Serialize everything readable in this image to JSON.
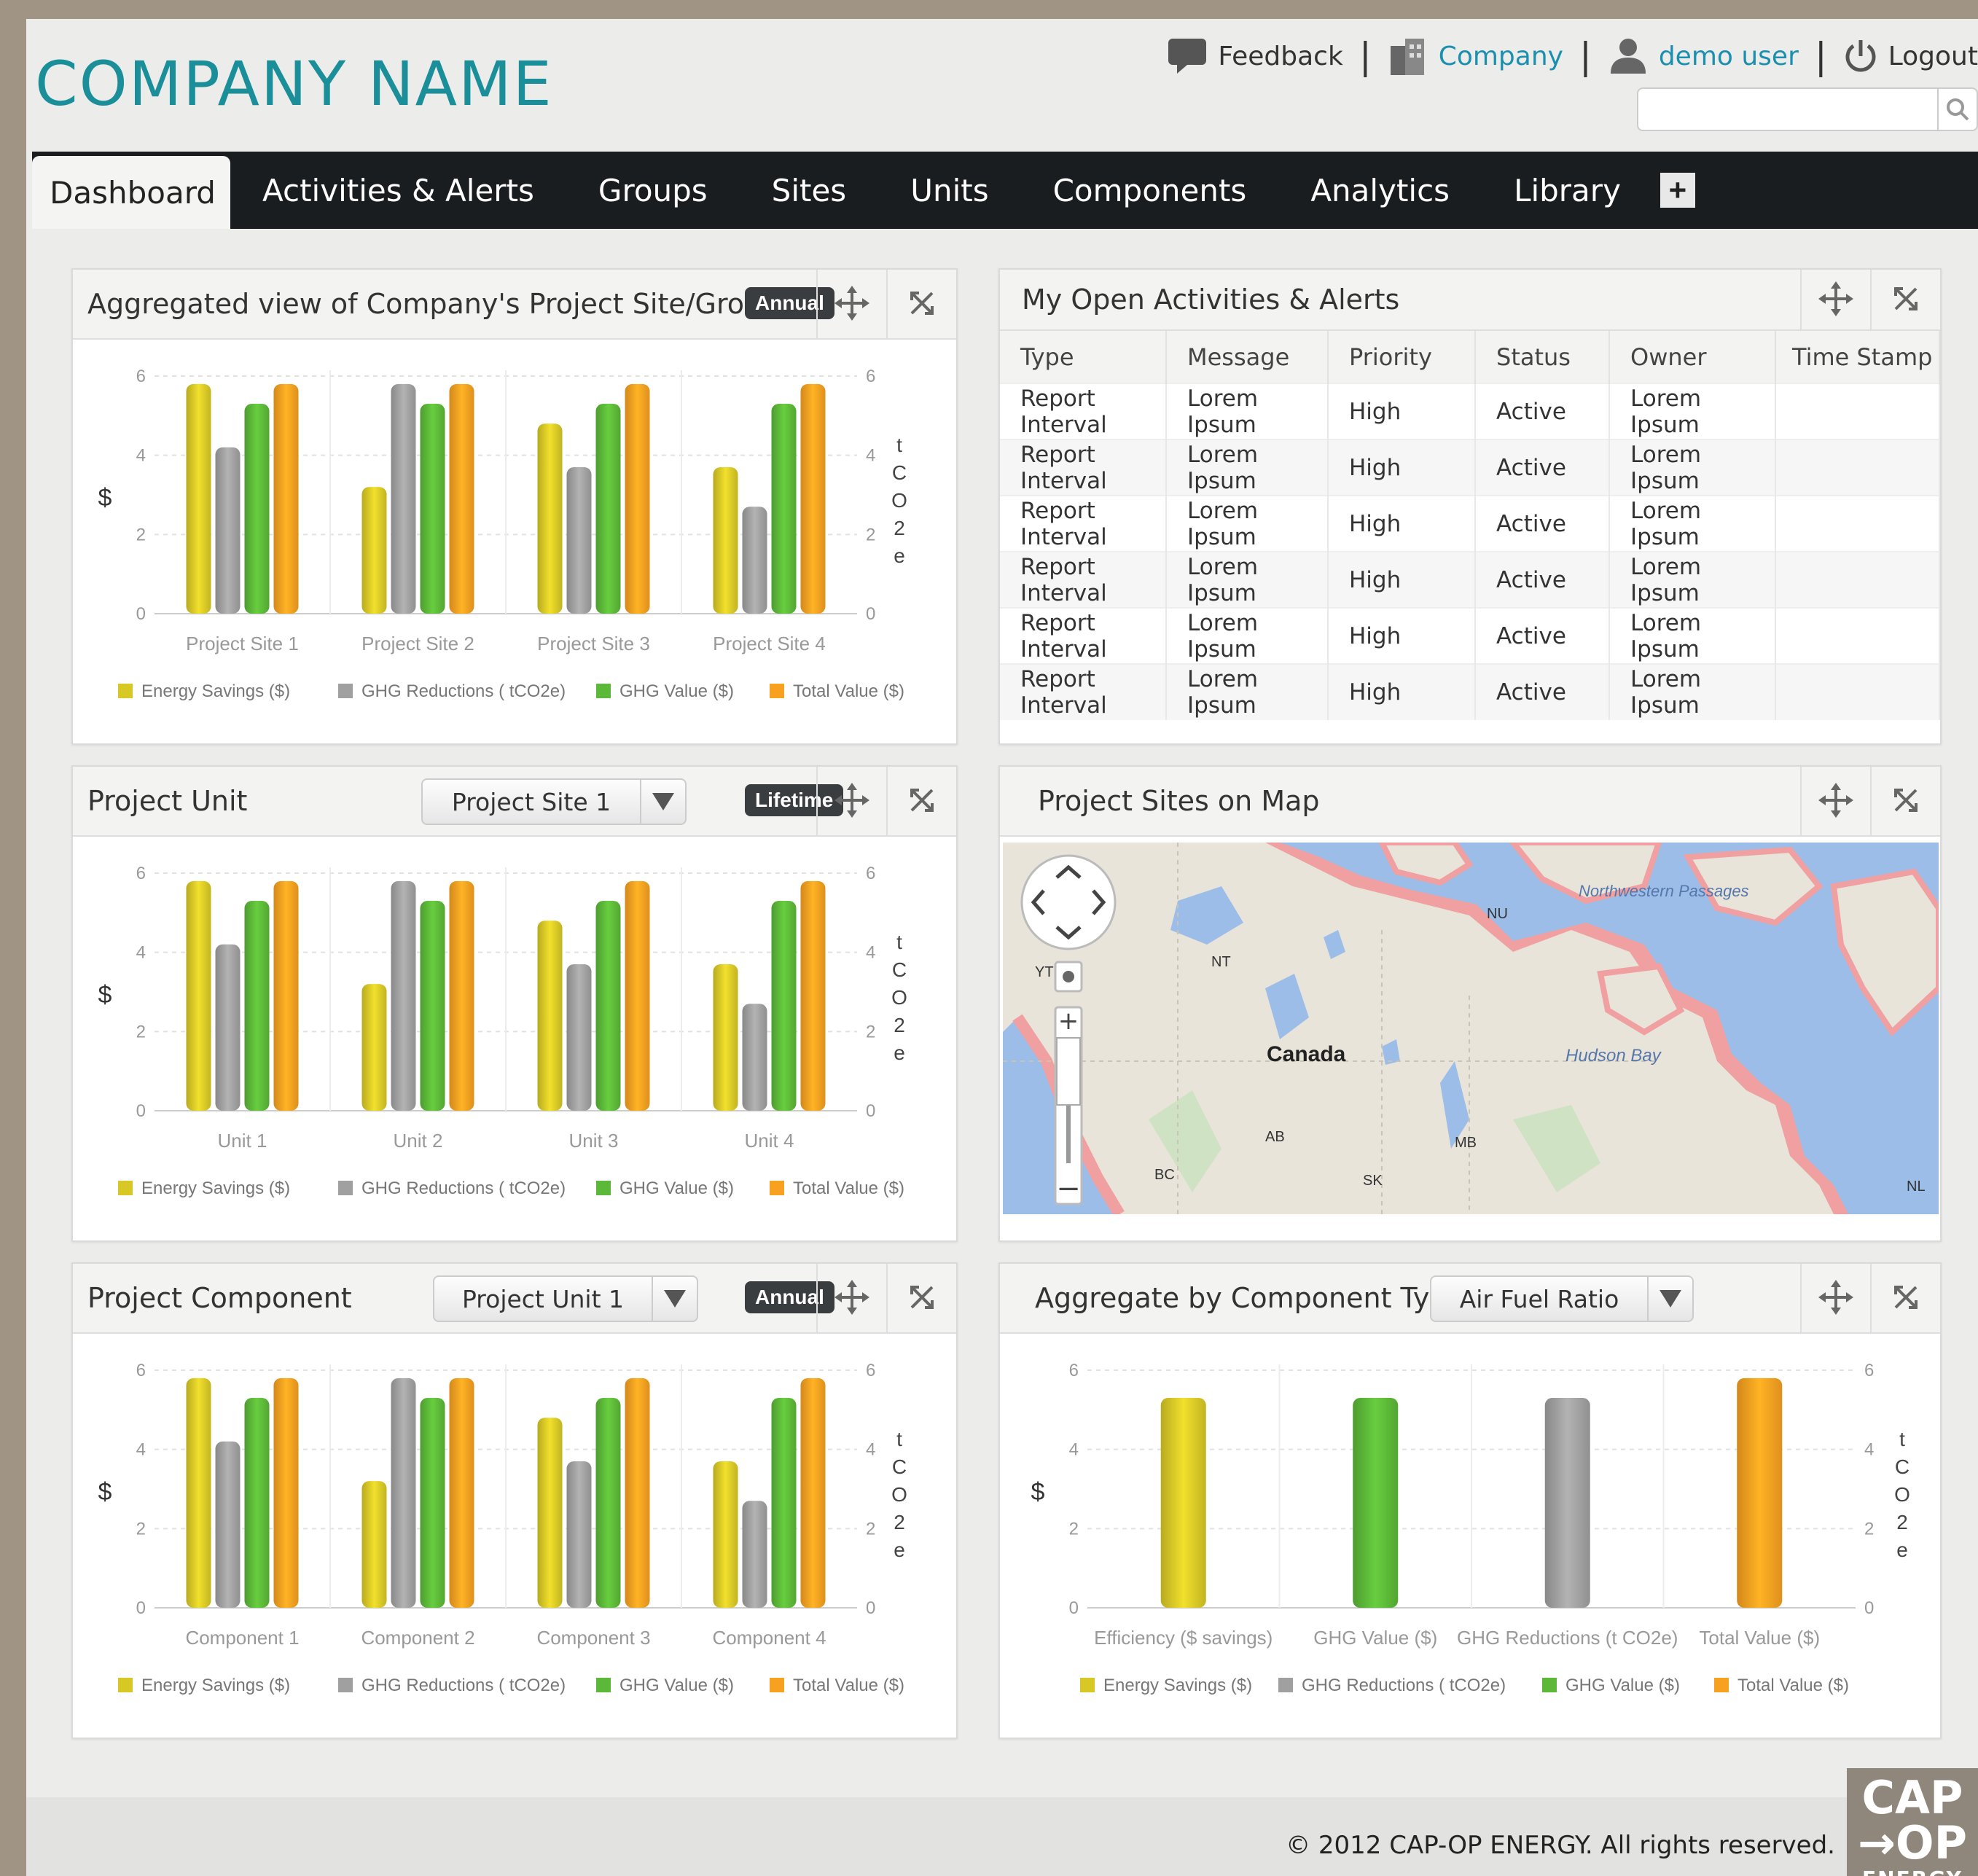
{
  "header": {
    "logo": "COMPANY NAME",
    "feedback": "Feedback",
    "company": "Company",
    "user": "demo user",
    "logout": "Logout",
    "search_placeholder": ""
  },
  "nav": {
    "tabs": [
      "Dashboard",
      "Activities & Alerts",
      "Groups",
      "Sites",
      "Units",
      "Components",
      "Analytics",
      "Library"
    ],
    "active": "Dashboard",
    "add_label": "+"
  },
  "legend": [
    "Energy Savings ($)",
    "GHG Reductions ( tCO2e)",
    "GHG Value ($)",
    "Total Value ($)"
  ],
  "colors": {
    "energy": "#d8c826",
    "ghg_red": "#a0a0a0",
    "ghg_val": "#5cb838",
    "total": "#f8a020",
    "accent": "#1a8f9a"
  },
  "axis": {
    "left_label": "$",
    "right_label": [
      "t",
      "C",
      "O",
      "2",
      "e"
    ]
  },
  "panels": {
    "aggregated": {
      "title": "Aggregated view of Company's  Project Site/Group",
      "badge": "Annual"
    },
    "activities": {
      "title": "My Open Activities & Alerts",
      "columns": [
        "Type",
        "Message",
        "Priority",
        "Status",
        "Owner",
        "Time Stamp"
      ],
      "rows": [
        [
          "Report Interval",
          "Lorem Ipsum",
          "High",
          "Active",
          "Lorem Ipsum",
          ""
        ],
        [
          "Report Interval",
          "Lorem Ipsum",
          "High",
          "Active",
          "Lorem Ipsum",
          ""
        ],
        [
          "Report Interval",
          "Lorem Ipsum",
          "High",
          "Active",
          "Lorem Ipsum",
          ""
        ],
        [
          "Report Interval",
          "Lorem Ipsum",
          "High",
          "Active",
          "Lorem Ipsum",
          ""
        ],
        [
          "Report Interval",
          "Lorem Ipsum",
          "High",
          "Active",
          "Lorem Ipsum",
          ""
        ],
        [
          "Report Interval",
          "Lorem Ipsum",
          "High",
          "Active",
          "Lorem Ipsum",
          ""
        ]
      ]
    },
    "unit": {
      "title": "Project Unit",
      "select": "Project Site 1",
      "badge": "Lifetime"
    },
    "map": {
      "title": "Project Sites on Map",
      "labels": [
        "Canada",
        "Hudson Bay",
        "Northwestern Passages",
        "NU",
        "NT",
        "YT",
        "AB",
        "MB",
        "BC",
        "SK",
        "NL"
      ]
    },
    "component": {
      "title": "Project Component",
      "select": "Project Unit 1",
      "badge": "Annual"
    },
    "aggregate_type": {
      "title": "Aggregate by Component Type:",
      "select": "Air Fuel Ratio"
    }
  },
  "chart_data": [
    {
      "type": "bar",
      "categories": [
        "Project Site 1",
        "Project Site 2",
        "Project Site 3",
        "Project Site 4"
      ],
      "series": [
        {
          "name": "Energy Savings ($)",
          "values": [
            5.8,
            3.2,
            4.8,
            3.7
          ]
        },
        {
          "name": "GHG Reductions ( tCO2e)",
          "values": [
            4.2,
            5.8,
            3.7,
            2.7
          ]
        },
        {
          "name": "GHG Value ($)",
          "values": [
            5.3,
            5.3,
            5.3,
            5.3
          ]
        },
        {
          "name": "Total Value ($)",
          "values": [
            5.8,
            5.8,
            5.8,
            5.8
          ]
        }
      ],
      "ylim": [
        0,
        6
      ],
      "yticks": [
        0,
        2,
        4,
        6
      ],
      "ylabel": "$",
      "y2label": "tCO2e"
    },
    {
      "type": "bar",
      "categories": [
        "Unit 1",
        "Unit 2",
        "Unit 3",
        "Unit 4"
      ],
      "series": [
        {
          "name": "Energy Savings ($)",
          "values": [
            5.8,
            3.2,
            4.8,
            3.7
          ]
        },
        {
          "name": "GHG Reductions ( tCO2e)",
          "values": [
            4.2,
            5.8,
            3.7,
            2.7
          ]
        },
        {
          "name": "GHG Value ($)",
          "values": [
            5.3,
            5.3,
            5.3,
            5.3
          ]
        },
        {
          "name": "Total Value ($)",
          "values": [
            5.8,
            5.8,
            5.8,
            5.8
          ]
        }
      ],
      "ylim": [
        0,
        6
      ],
      "yticks": [
        0,
        2,
        4,
        6
      ],
      "ylabel": "$",
      "y2label": "tCO2e"
    },
    {
      "type": "bar",
      "categories": [
        "Component 1",
        "Component 2",
        "Component 3",
        "Component 4"
      ],
      "series": [
        {
          "name": "Energy Savings ($)",
          "values": [
            5.8,
            3.2,
            4.8,
            3.7
          ]
        },
        {
          "name": "GHG Reductions ( tCO2e)",
          "values": [
            4.2,
            5.8,
            3.7,
            2.7
          ]
        },
        {
          "name": "GHG Value ($)",
          "values": [
            5.3,
            5.3,
            5.3,
            5.3
          ]
        },
        {
          "name": "Total Value ($)",
          "values": [
            5.8,
            5.8,
            5.8,
            5.8
          ]
        }
      ],
      "ylim": [
        0,
        6
      ],
      "yticks": [
        0,
        2,
        4,
        6
      ],
      "ylabel": "$",
      "y2label": "tCO2e"
    },
    {
      "type": "bar",
      "categories": [
        "Efficiency ($ savings)",
        "GHG Value ($)",
        "GHG Reductions (t CO2e)",
        "Total Value ($)"
      ],
      "values": [
        5.3,
        5.3,
        5.3,
        5.8
      ],
      "colors": [
        "#d8c826",
        "#5cb838",
        "#a0a0a0",
        "#f8a020"
      ],
      "ylim": [
        0,
        6
      ],
      "yticks": [
        0,
        2,
        4,
        6
      ],
      "ylabel": "$",
      "y2label": "tCO2e"
    }
  ],
  "footer": {
    "copyright": "© 2012 CAP-OP ENERGY. All rights reserved.",
    "logo_lines": [
      "CAP",
      "→OP",
      "ENERGY"
    ]
  }
}
